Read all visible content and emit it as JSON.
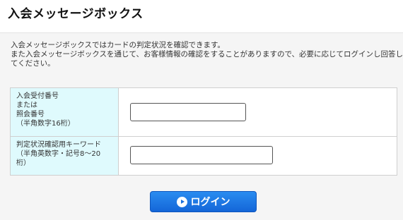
{
  "header": {
    "title": "入会メッセージボックス"
  },
  "description": [
    "入会メッセージボックスではカードの判定状況を確認できます。",
    "また入会メッセージボックスを通じて、お客様情報の確認をすることがありますので、必要に応じてログインし回答し",
    "てください。"
  ],
  "form": {
    "field1": {
      "label_lines": [
        "入会受付番号",
        "または",
        "照会番号",
        "（半角数字16桁）"
      ],
      "value": "",
      "placeholder": ""
    },
    "field2": {
      "label_lines": [
        "判定状況確認用キーワード",
        "（半角英数字・記号8〜20",
        "桁）"
      ],
      "value": "",
      "placeholder": ""
    }
  },
  "login_button": {
    "label": "ログイン",
    "icon": "circle-arrow-right-icon"
  },
  "colors": {
    "label_bg": "#dffafd",
    "button": "#1a70de"
  }
}
